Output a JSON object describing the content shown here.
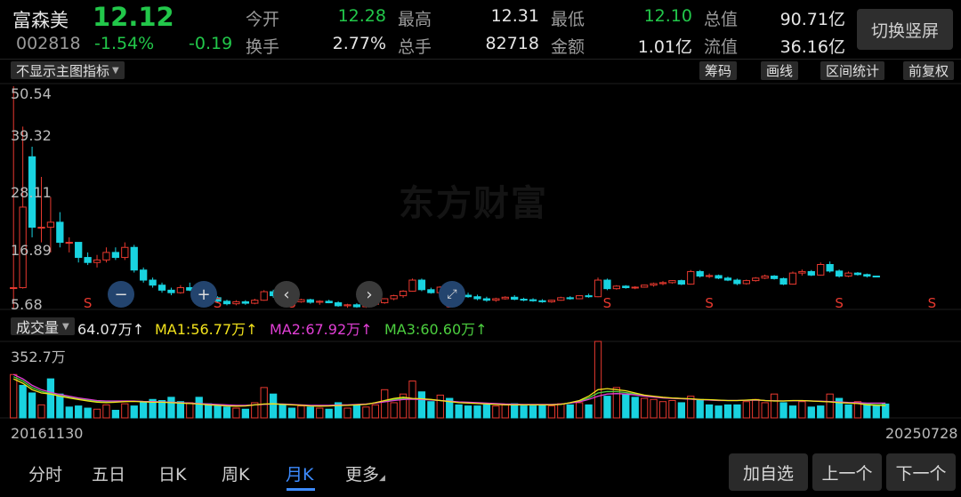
{
  "stock": {
    "name": "富森美",
    "price": "12.12",
    "code": "002818",
    "change_pct": "-1.54%",
    "change": "-0.19"
  },
  "stats": {
    "row1": [
      {
        "label": "今开",
        "value": "12.28",
        "color": "#22c74a"
      },
      {
        "label": "最高",
        "value": "12.31",
        "color": "#e6e6e6"
      },
      {
        "label": "最低",
        "value": "12.10",
        "color": "#22c74a"
      },
      {
        "label": "总值",
        "value": "90.71亿",
        "color": "#e6e6e6"
      }
    ],
    "row2": [
      {
        "label": "换手",
        "value": "2.77%",
        "color": "#e6e6e6"
      },
      {
        "label": "总手",
        "value": "82718",
        "color": "#e6e6e6"
      },
      {
        "label": "金额",
        "value": "1.01亿",
        "color": "#e6e6e6"
      },
      {
        "label": "流值",
        "value": "36.16亿",
        "color": "#e6e6e6"
      }
    ]
  },
  "switch_label": "切换竖屏",
  "toolbar": {
    "indicator_select": "不显示主图指标",
    "buttons": [
      "筹码",
      "画线",
      "区间统计",
      "前复权"
    ]
  },
  "watermark": "东方财富",
  "main_axis": [
    "50.54",
    "39.32",
    "28.11",
    "16.89",
    "5.68"
  ],
  "signal_label": "S",
  "volume": {
    "select": "成交量",
    "current": "64.07万↑",
    "ma1": "MA1:56.77万↑",
    "ma2": "MA2:67.92万↑",
    "ma3": "MA3:60.60万↑",
    "axis_max": "352.7万"
  },
  "dates": {
    "start": "20161130",
    "end": "20250728"
  },
  "tabs": [
    "分时",
    "五日",
    "日K",
    "周K",
    "月K",
    "更多"
  ],
  "active_tab": "月K",
  "buttons": {
    "add": "加自选",
    "prev": "上一个",
    "next": "下一个"
  },
  "colors": {
    "up": "#e8392f",
    "down": "#19d3e0",
    "ma1": "#f2e21c",
    "ma2": "#e23fd6",
    "ma3": "#4ccf3f"
  },
  "chart_data": {
    "type": "candlestick",
    "ylim": [
      5.68,
      50.54
    ],
    "vol_max": 352.7,
    "candles": [
      [
        10,
        50,
        5.7,
        10
      ],
      [
        10,
        42,
        9.8,
        26
      ],
      [
        36,
        38,
        20,
        22
      ],
      [
        22,
        32,
        19,
        22
      ],
      [
        22,
        28,
        17,
        23
      ],
      [
        23,
        25,
        18,
        19
      ],
      [
        19,
        20,
        17,
        19
      ],
      [
        19,
        19,
        15,
        16
      ],
      [
        16,
        17,
        14.5,
        15
      ],
      [
        15,
        16.5,
        14,
        15.5
      ],
      [
        15.5,
        18,
        15,
        17
      ],
      [
        17,
        18,
        15.5,
        16
      ],
      [
        16,
        19,
        15.5,
        18
      ],
      [
        18,
        18.5,
        13,
        13.5
      ],
      [
        13.5,
        14,
        11,
        11.5
      ],
      [
        11.5,
        12,
        10,
        10.5
      ],
      [
        10.5,
        11,
        9,
        9.5
      ],
      [
        9.5,
        10,
        8.5,
        9
      ],
      [
        9,
        10.5,
        8.8,
        10
      ],
      [
        10,
        11,
        9.3,
        9.5
      ],
      [
        9.5,
        10,
        8.5,
        9
      ],
      [
        9,
        9.5,
        7.6,
        8
      ],
      [
        8,
        8.3,
        7,
        7.3
      ],
      [
        7.3,
        7.6,
        6.5,
        6.8
      ],
      [
        6.8,
        7.5,
        6.5,
        7.2
      ],
      [
        7.2,
        7.5,
        6.6,
        6.9
      ],
      [
        6.9,
        7.8,
        6.7,
        7.5
      ],
      [
        7.5,
        9.5,
        7.4,
        9.2
      ],
      [
        9.2,
        9.6,
        8,
        8.4
      ],
      [
        8.4,
        8.8,
        7.8,
        8.1
      ],
      [
        8.1,
        8.3,
        7,
        7.2
      ],
      [
        7.2,
        7.8,
        7,
        7.6
      ],
      [
        7.6,
        7.8,
        6.8,
        7.1
      ],
      [
        7.1,
        7.5,
        6.6,
        7.3
      ],
      [
        7.3,
        7.6,
        6.9,
        7
      ],
      [
        7,
        7.3,
        6.2,
        6.4
      ],
      [
        6.4,
        6.8,
        6,
        6.6
      ],
      [
        6.6,
        6.9,
        6,
        6.2
      ],
      [
        6.2,
        6.8,
        6,
        6.7
      ],
      [
        6.7,
        7.2,
        6.5,
        7
      ],
      [
        7,
        7.9,
        6.8,
        7.8
      ],
      [
        7.8,
        8.6,
        7.5,
        8.4
      ],
      [
        8.4,
        9.5,
        8,
        9.3
      ],
      [
        9.3,
        11.8,
        9.2,
        11.5
      ],
      [
        11.5,
        11.8,
        9.3,
        9.6
      ],
      [
        9.6,
        10,
        8.8,
        9
      ],
      [
        9,
        10.3,
        8.8,
        10.1
      ],
      [
        10.1,
        10.5,
        8.5,
        8.7
      ],
      [
        8.7,
        9.2,
        8,
        8.5
      ],
      [
        8.5,
        9,
        8,
        8.2
      ],
      [
        8.2,
        8.6,
        7.5,
        7.8
      ],
      [
        7.8,
        8.2,
        7.2,
        7.5
      ],
      [
        7.5,
        8,
        7.2,
        7.8
      ],
      [
        7.8,
        8.3,
        7.6,
        8.1
      ],
      [
        8.1,
        8.5,
        7.5,
        7.7
      ],
      [
        7.7,
        8,
        7.3,
        7.6
      ],
      [
        7.6,
        7.9,
        7.2,
        7.4
      ],
      [
        7.4,
        7.7,
        7,
        7.2
      ],
      [
        7.2,
        7.6,
        7,
        7.5
      ],
      [
        7.5,
        8.2,
        7.4,
        8
      ],
      [
        8,
        8.3,
        7.6,
        7.8
      ],
      [
        7.8,
        8.5,
        7.7,
        8.4
      ],
      [
        8.4,
        8.8,
        8,
        8.2
      ],
      [
        8.2,
        12,
        8.1,
        11.5
      ],
      [
        11.5,
        11.8,
        9.5,
        9.8
      ],
      [
        9.8,
        10.5,
        9.6,
        10.3
      ],
      [
        10.3,
        10.5,
        9.8,
        10
      ],
      [
        10,
        10.3,
        9.7,
        10.1
      ],
      [
        10.1,
        10.6,
        10,
        10.5
      ],
      [
        10.5,
        11,
        10.2,
        10.8
      ],
      [
        10.8,
        11.3,
        10.5,
        11
      ],
      [
        11,
        11.5,
        10.8,
        11.4
      ],
      [
        11.4,
        11.6,
        10.5,
        10.7
      ],
      [
        10.7,
        13.5,
        10.6,
        13.2
      ],
      [
        13.2,
        13.5,
        12,
        12.3
      ],
      [
        12.3,
        12.8,
        11.9,
        12.4
      ],
      [
        12.4,
        12.6,
        11.7,
        11.9
      ],
      [
        11.9,
        12.2,
        11.3,
        11.5
      ],
      [
        11.5,
        11.8,
        10.5,
        10.8
      ],
      [
        10.8,
        11.6,
        10.6,
        11.4
      ],
      [
        11.4,
        12.1,
        11.2,
        11.9
      ],
      [
        11.9,
        12.6,
        11.7,
        12.3
      ],
      [
        12.3,
        12.5,
        11.6,
        11.8
      ],
      [
        11.8,
        12,
        10.5,
        10.7
      ],
      [
        10.7,
        13.2,
        10.6,
        12.9
      ],
      [
        12.9,
        13.6,
        12.4,
        13.2
      ],
      [
        13.2,
        13.5,
        12.3,
        12.5
      ],
      [
        12.5,
        15,
        12.4,
        14.6
      ],
      [
        14.6,
        15.2,
        13,
        13.3
      ],
      [
        13.3,
        13.6,
        12,
        12.3
      ],
      [
        12.3,
        13.2,
        12.1,
        12.9
      ],
      [
        12.9,
        13.1,
        12.4,
        12.6
      ],
      [
        12.6,
        12.8,
        12,
        12.3
      ],
      [
        12.3,
        12.31,
        12.1,
        12.12
      ]
    ],
    "volumes": [
      [
        200,
        1
      ],
      [
        150,
        0
      ],
      [
        115,
        0
      ],
      [
        60,
        1
      ],
      [
        180,
        0
      ],
      [
        110,
        0
      ],
      [
        50,
        0
      ],
      [
        55,
        0
      ],
      [
        45,
        0
      ],
      [
        40,
        1
      ],
      [
        60,
        1
      ],
      [
        35,
        0
      ],
      [
        65,
        1
      ],
      [
        55,
        0
      ],
      [
        70,
        0
      ],
      [
        85,
        0
      ],
      [
        80,
        0
      ],
      [
        95,
        0
      ],
      [
        75,
        0
      ],
      [
        70,
        1
      ],
      [
        95,
        0
      ],
      [
        65,
        0
      ],
      [
        55,
        0
      ],
      [
        50,
        0
      ],
      [
        45,
        1
      ],
      [
        40,
        0
      ],
      [
        70,
        1
      ],
      [
        140,
        1
      ],
      [
        110,
        0
      ],
      [
        60,
        0
      ],
      [
        45,
        0
      ],
      [
        55,
        1
      ],
      [
        50,
        0
      ],
      [
        45,
        1
      ],
      [
        40,
        0
      ],
      [
        70,
        0
      ],
      [
        45,
        1
      ],
      [
        60,
        0
      ],
      [
        50,
        1
      ],
      [
        60,
        1
      ],
      [
        130,
        1
      ],
      [
        70,
        1
      ],
      [
        110,
        1
      ],
      [
        170,
        1
      ],
      [
        120,
        0
      ],
      [
        75,
        0
      ],
      [
        105,
        1
      ],
      [
        90,
        0
      ],
      [
        60,
        0
      ],
      [
        55,
        0
      ],
      [
        55,
        0
      ],
      [
        60,
        0
      ],
      [
        55,
        1
      ],
      [
        60,
        1
      ],
      [
        65,
        0
      ],
      [
        55,
        0
      ],
      [
        55,
        0
      ],
      [
        60,
        0
      ],
      [
        55,
        1
      ],
      [
        65,
        1
      ],
      [
        60,
        0
      ],
      [
        70,
        1
      ],
      [
        60,
        0
      ],
      [
        360,
        1
      ],
      [
        100,
        0
      ],
      [
        140,
        1
      ],
      [
        110,
        0
      ],
      [
        95,
        0
      ],
      [
        90,
        1
      ],
      [
        85,
        1
      ],
      [
        75,
        1
      ],
      [
        80,
        1
      ],
      [
        70,
        0
      ],
      [
        100,
        1
      ],
      [
        85,
        0
      ],
      [
        60,
        0
      ],
      [
        55,
        0
      ],
      [
        60,
        0
      ],
      [
        60,
        0
      ],
      [
        75,
        1
      ],
      [
        85,
        1
      ],
      [
        70,
        1
      ],
      [
        110,
        1
      ],
      [
        70,
        0
      ],
      [
        55,
        0
      ],
      [
        75,
        1
      ],
      [
        50,
        0
      ],
      [
        55,
        0
      ],
      [
        110,
        1
      ],
      [
        90,
        0
      ],
      [
        60,
        0
      ],
      [
        75,
        1
      ],
      [
        65,
        0
      ],
      [
        60,
        0
      ],
      [
        64,
        0
      ]
    ],
    "signals": [
      8,
      22,
      30,
      47,
      64,
      75,
      89,
      99,
      117,
      125,
      135,
      145,
      164,
      169
    ],
    "ma1": [
      180,
      160,
      130,
      115,
      110,
      100,
      92,
      85,
      78,
      72,
      70,
      72,
      75,
      76,
      74,
      72,
      72,
      70,
      68,
      66,
      64,
      60,
      58,
      55,
      54,
      55,
      60,
      64,
      65,
      62,
      60,
      58,
      55,
      54,
      55,
      57,
      58,
      60,
      62,
      70,
      80,
      90,
      95,
      90,
      88,
      85,
      80,
      75,
      70,
      68,
      66,
      64,
      62,
      60,
      60,
      60,
      60,
      60,
      60,
      62,
      70,
      80,
      100,
      130,
      135,
      130,
      125,
      115,
      105,
      100,
      95,
      92,
      90,
      88,
      85,
      84,
      82,
      80,
      80,
      82,
      84,
      80,
      78,
      78,
      80,
      80,
      78,
      76,
      74,
      70,
      68,
      66,
      60,
      58,
      57
    ],
    "ma2": [
      200,
      180,
      150,
      130,
      118,
      108,
      100,
      92,
      86,
      80,
      78,
      78,
      78,
      78,
      76,
      75,
      74,
      72,
      70,
      68,
      66,
      64,
      62,
      60,
      58,
      58,
      60,
      62,
      64,
      64,
      62,
      60,
      58,
      58,
      58,
      60,
      60,
      62,
      64,
      68,
      74,
      80,
      85,
      86,
      85,
      83,
      80,
      77,
      74,
      72,
      70,
      68,
      66,
      64,
      63,
      62,
      62,
      62,
      62,
      64,
      68,
      74,
      85,
      100,
      110,
      112,
      110,
      106,
      100,
      96,
      92,
      90,
      88,
      86,
      84,
      82,
      80,
      80,
      80,
      81,
      82,
      80,
      79,
      78,
      79,
      79,
      78,
      77,
      75,
      73,
      71,
      70,
      68,
      68,
      68
    ],
    "ma3": [
      190,
      170,
      140,
      122,
      112,
      104,
      96,
      88,
      82,
      76,
      74,
      74,
      76,
      77,
      75,
      73,
      73,
      71,
      69,
      67,
      65,
      62,
      60,
      57,
      56,
      56,
      60,
      63,
      64,
      63,
      61,
      59,
      56,
      56,
      56,
      58,
      59,
      61,
      63,
      69,
      77,
      85,
      90,
      88,
      86,
      84,
      80,
      76,
      72,
      70,
      68,
      66,
      64,
      62,
      61,
      61,
      61,
      61,
      61,
      63,
      69,
      77,
      92,
      115,
      122,
      121,
      117,
      110,
      102,
      98,
      93,
      91,
      89,
      87,
      84,
      83,
      81,
      80,
      80,
      81,
      83,
      80,
      78,
      78,
      79,
      79,
      78,
      76,
      74,
      71,
      69,
      68,
      63,
      61,
      61
    ]
  }
}
